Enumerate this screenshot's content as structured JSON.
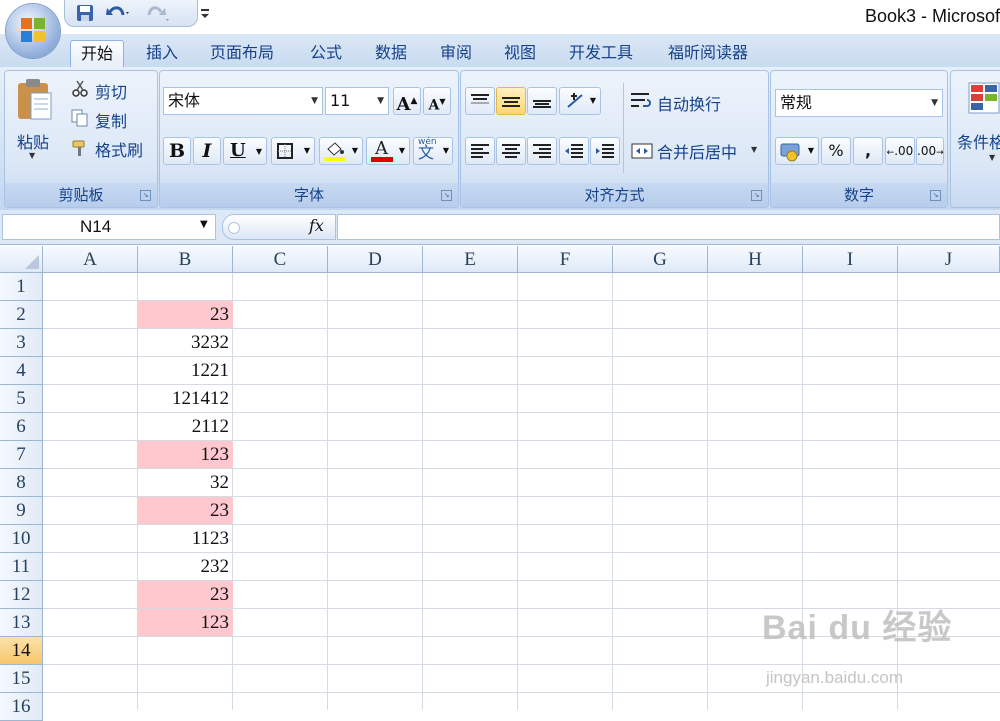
{
  "window": {
    "title": "Book3 - Microsof"
  },
  "tabs": [
    {
      "label": "开始",
      "active": true
    },
    {
      "label": "插入"
    },
    {
      "label": "页面布局"
    },
    {
      "label": "公式"
    },
    {
      "label": "数据"
    },
    {
      "label": "审阅"
    },
    {
      "label": "视图"
    },
    {
      "label": "开发工具"
    },
    {
      "label": "福昕阅读器"
    }
  ],
  "ribbon": {
    "clipboard": {
      "label": "剪贴板",
      "paste": "粘贴",
      "cut": "剪切",
      "copy": "复制",
      "format_painter": "格式刷"
    },
    "font": {
      "label": "字体",
      "font_name": "宋体",
      "font_size": "11",
      "bold": "B",
      "italic": "I",
      "underline": "U",
      "grow": "A",
      "shrink": "A",
      "font_color_glyph": "A",
      "phonetic_top": "wén",
      "phonetic_main": "文"
    },
    "alignment": {
      "label": "对齐方式",
      "wrap_text": "自动换行",
      "merge_center": "合并后居中"
    },
    "number": {
      "label": "数字",
      "format": "常规",
      "percent": "%",
      "comma": ",",
      "inc_decimal": ".00",
      "dec_decimal": ".00"
    },
    "styles": {
      "conditional": "条件格"
    },
    "colors": {
      "font_color": "#e00000",
      "fill_color": "#ffff00",
      "accent": "#15428b"
    }
  },
  "formula_bar": {
    "name_box": "N14",
    "fx": "fx",
    "formula": ""
  },
  "sheet": {
    "columns": [
      "A",
      "B",
      "C",
      "D",
      "E",
      "F",
      "G",
      "H",
      "I",
      "J"
    ],
    "rows": [
      "1",
      "2",
      "3",
      "4",
      "5",
      "6",
      "7",
      "8",
      "9",
      "10",
      "11",
      "12",
      "13",
      "14",
      "15",
      "16"
    ],
    "selected_row": "14",
    "highlight_color": "#ffc7ce",
    "column_b": [
      {
        "row": "2",
        "value": "23",
        "highlight": true
      },
      {
        "row": "3",
        "value": "3232",
        "highlight": false
      },
      {
        "row": "4",
        "value": "1221",
        "highlight": false
      },
      {
        "row": "5",
        "value": "121412",
        "highlight": false
      },
      {
        "row": "6",
        "value": "2112",
        "highlight": false
      },
      {
        "row": "7",
        "value": "123",
        "highlight": true
      },
      {
        "row": "8",
        "value": "32",
        "highlight": false
      },
      {
        "row": "9",
        "value": "23",
        "highlight": true
      },
      {
        "row": "10",
        "value": "1123",
        "highlight": false
      },
      {
        "row": "11",
        "value": "232",
        "highlight": false
      },
      {
        "row": "12",
        "value": "23",
        "highlight": true
      },
      {
        "row": "13",
        "value": "123",
        "highlight": true
      }
    ]
  },
  "watermark": {
    "main": "Bai du 经验",
    "sub": "jingyan.baidu.com"
  }
}
